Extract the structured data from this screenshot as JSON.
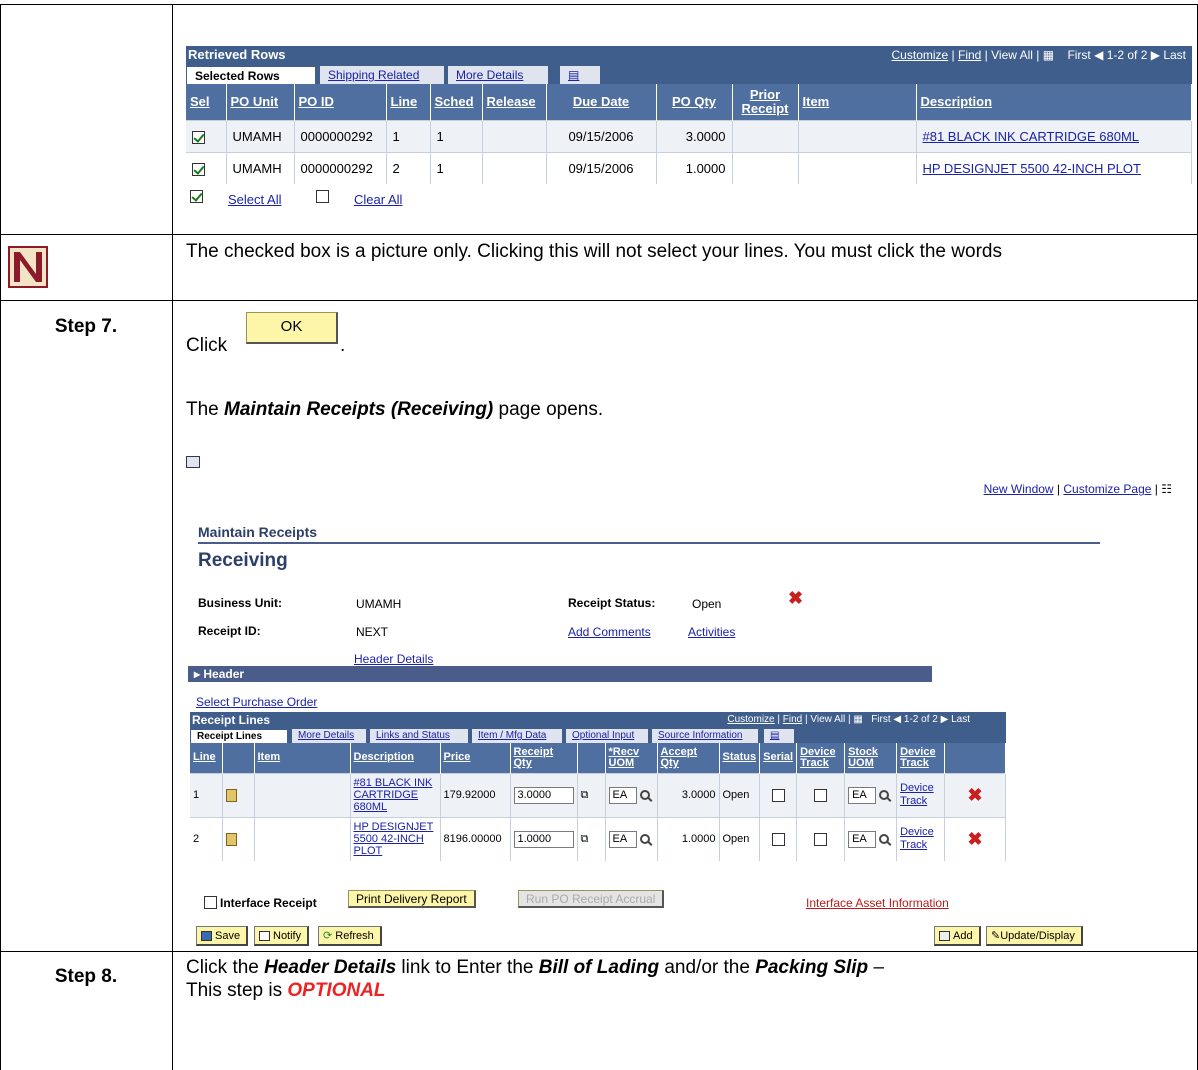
{
  "retrieved_rows": {
    "title": "Retrieved Rows",
    "nav": {
      "customize": "Customize",
      "find": "Find",
      "view_all": "View All",
      "first": "First",
      "range": "1-2 of 2",
      "last": "Last"
    },
    "tabs": [
      "Selected Rows",
      "Shipping Related",
      "More Details"
    ],
    "columns": [
      "Sel",
      "PO Unit",
      "PO ID",
      "Line",
      "Sched",
      "Release",
      "Due Date",
      "PO Qty",
      "Prior Receipt",
      "Item",
      "Description"
    ],
    "rows": [
      {
        "po_unit": "UMAMH",
        "po_id": "0000000292",
        "line": "1",
        "sched": "1",
        "release": "",
        "due_date": "09/15/2006",
        "po_qty": "3.0000",
        "prior_receipt": "",
        "item": "",
        "description": "#81 BLACK INK CARTRIDGE 680ML"
      },
      {
        "po_unit": "UMAMH",
        "po_id": "0000000292",
        "line": "2",
        "sched": "1",
        "release": "",
        "due_date": "09/15/2006",
        "po_qty": "1.0000",
        "prior_receipt": "",
        "item": "",
        "description": "HP DESIGNJET 5500 42-INCH PLOT"
      }
    ],
    "select_all": "Select All",
    "clear_all": "Clear All"
  },
  "note": "The checked box is a picture only.  Clicking this will not select your lines.  You must click the words",
  "step7": {
    "label": "Step 7.",
    "click": "Click",
    "ok": "OK",
    "period": ".",
    "opens_bold": "Maintain Receipts (Receiving)",
    "opens_rest": " page opens.",
    "the": "The "
  },
  "maintain": {
    "new_window": "New Window",
    "customize_page": "Customize Page",
    "breadcrumb": "Maintain Receipts",
    "heading": "Receiving",
    "business_unit_label": "Business Unit:",
    "business_unit": "UMAMH",
    "receipt_status_label": "Receipt Status:",
    "receipt_status": "Open",
    "receipt_id_label": "Receipt ID:",
    "receipt_id": "NEXT",
    "add_comments": "Add Comments",
    "activities": "Activities",
    "header_details": "Header Details",
    "header": "Header",
    "select_po": "Select Purchase Order",
    "lines_title": "Receipt Lines",
    "lines_nav": {
      "customize": "Customize",
      "find": "Find",
      "view_all": "View All",
      "first": "First",
      "range": "1-2 of 2",
      "last": "Last"
    },
    "lines_tabs": [
      "Receipt Lines",
      "More Details",
      "Links and Status",
      "Item / Mfg Data",
      "Optional Input",
      "Source Information"
    ],
    "columns": [
      "Line",
      "",
      "Item",
      "Description",
      "Price",
      "Receipt Qty",
      "",
      "*Recv UOM",
      "Accept Qty",
      "Status",
      "Serial",
      "Device Track",
      "Stock UOM",
      "Device Track"
    ],
    "lines": [
      {
        "line": "1",
        "desc": "#81 BLACK INK CARTRIDGE 680ML",
        "price": "179.92000",
        "qty": "3.0000",
        "uom": "EA",
        "accept": "3.0000",
        "status": "Open",
        "stock_uom": "EA",
        "device": "Device Track"
      },
      {
        "line": "2",
        "desc": "HP DESIGNJET 5500 42-INCH PLOT",
        "price": "8196.00000",
        "qty": "1.0000",
        "uom": "EA",
        "accept": "1.0000",
        "status": "Open",
        "stock_uom": "EA",
        "device": "Device Track"
      }
    ],
    "interface_receipt": "Interface Receipt",
    "print_delivery": "Print Delivery Report",
    "run_po": "Run PO Receipt Accrual",
    "interface_asset": "Interface Asset Information",
    "save": "Save",
    "notify": "Notify",
    "refresh": "Refresh",
    "add": "Add",
    "update_display": "Update/Display"
  },
  "step8": {
    "label": "Step 8.",
    "t1": "Click the ",
    "b1": "Header Details",
    "t2": " link to Enter the ",
    "b2": "Bill of Lading",
    "t3": " and/or the ",
    "b3": "Packing Slip",
    "t4": " –",
    "t5": "This step is ",
    "optional": "OPTIONAL"
  },
  "colors": {
    "optional": "#ee2222",
    "grid_header": "#4f6fa1",
    "link": "#1a22a8"
  }
}
